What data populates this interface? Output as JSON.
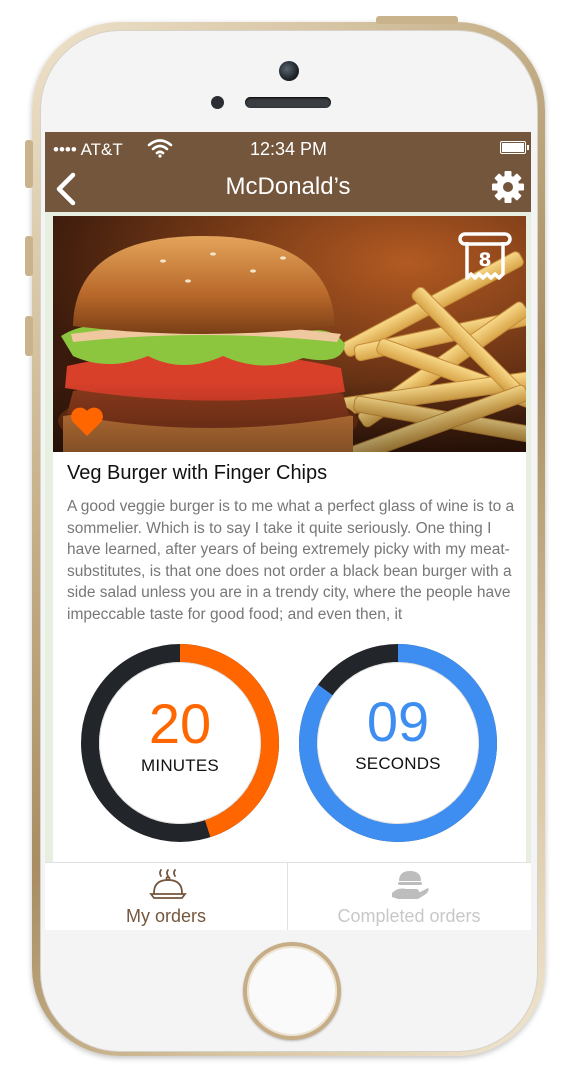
{
  "status_bar": {
    "carrier": "•••• AT&T",
    "time": "12:34 PM"
  },
  "header": {
    "title": "McDonald’s"
  },
  "order": {
    "ticket_number": "8",
    "dish_title": "Veg Burger with Finger Chips",
    "description": "A good veggie burger is to me what a perfect glass of wine is to a sommelier. Which is to say I take it quite seriously. One thing I have learned, after years of being extremely picky with my meat-substitutes, is that one does not order a black bean burger with a side salad unless you are in a trendy city, where the people have impeccable taste for good food; and even then, it",
    "favorited": true
  },
  "timer": {
    "minutes": {
      "value": "20",
      "label": "MINUTES",
      "progress": 0.45,
      "color": "#ff6600"
    },
    "seconds": {
      "value": "09",
      "label": "SECONDS",
      "progress": 0.85,
      "color": "#3d8ef0"
    }
  },
  "tabs": [
    {
      "label": "My orders",
      "icon": "cloche-icon",
      "active": true
    },
    {
      "label": "Completed orders",
      "icon": "served-hand-icon",
      "active": false
    }
  ],
  "colors": {
    "header": "#74563d",
    "accent_orange": "#ff6600",
    "accent_blue": "#3d8ef0",
    "ring_track": "#22252a"
  }
}
